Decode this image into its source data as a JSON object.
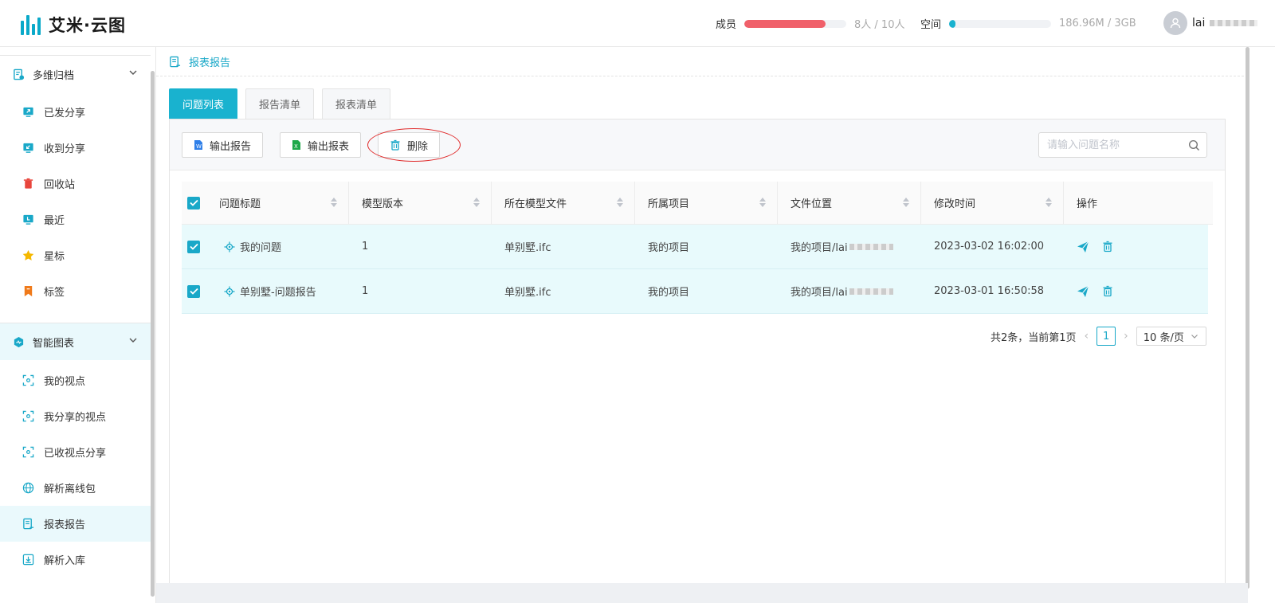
{
  "app": {
    "brand": "艾米·云图"
  },
  "header": {
    "members": {
      "label": "成员",
      "value_text": "8人 / 10人",
      "fill_fraction": 0.8,
      "color": "#f0606a"
    },
    "storage": {
      "label": "空间",
      "value_text": "186.96M / 3GB",
      "fill_fraction": 0.06,
      "color": "#19b2cf"
    },
    "user": {
      "name": "lai"
    }
  },
  "sidebar": {
    "group1": {
      "label": "多维归档"
    },
    "items1": [
      {
        "label": "已发分享",
        "icon": "share-out-icon"
      },
      {
        "label": "收到分享",
        "icon": "share-in-icon"
      },
      {
        "label": "回收站",
        "icon": "trash-icon"
      },
      {
        "label": "最近",
        "icon": "recent-icon"
      },
      {
        "label": "星标",
        "icon": "star-icon"
      },
      {
        "label": "标签",
        "icon": "tag-icon"
      }
    ],
    "group2": {
      "label": "智能图表"
    },
    "items2": [
      {
        "label": "我的视点",
        "icon": "viewpoint-icon"
      },
      {
        "label": "我分享的视点",
        "icon": "viewpoint-icon"
      },
      {
        "label": "已收视点分享",
        "icon": "viewpoint-icon"
      },
      {
        "label": "解析离线包",
        "icon": "globe-icon"
      },
      {
        "label": "报表报告",
        "icon": "report-icon",
        "active": true
      },
      {
        "label": "解析入库",
        "icon": "import-icon"
      }
    ]
  },
  "breadcrumb": {
    "label": "报表报告"
  },
  "tabs": [
    {
      "label": "问题列表",
      "active": true
    },
    {
      "label": "报告清单"
    },
    {
      "label": "报表清单"
    }
  ],
  "toolbar": {
    "export_report": "输出报告",
    "export_sheet": "输出报表",
    "delete": "删除",
    "search_placeholder": "请输入问题名称"
  },
  "table": {
    "columns": [
      "问题标题",
      "模型版本",
      "所在模型文件",
      "所属项目",
      "文件位置",
      "修改时间",
      "操作"
    ],
    "rows": [
      {
        "title": "我的问题",
        "version": "1",
        "file": "单别墅.ifc",
        "project": "我的项目",
        "location": "我的项目/lai",
        "time": "2023-03-02 16:02:00"
      },
      {
        "title": "单别墅-问题报告",
        "version": "1",
        "file": "单别墅.ifc",
        "project": "我的项目",
        "location": "我的项目/lai",
        "time": "2023-03-01 16:50:58"
      }
    ]
  },
  "pagination": {
    "summary": "共2条，当前第1页",
    "current_page": "1",
    "page_size": "10 条/页"
  }
}
